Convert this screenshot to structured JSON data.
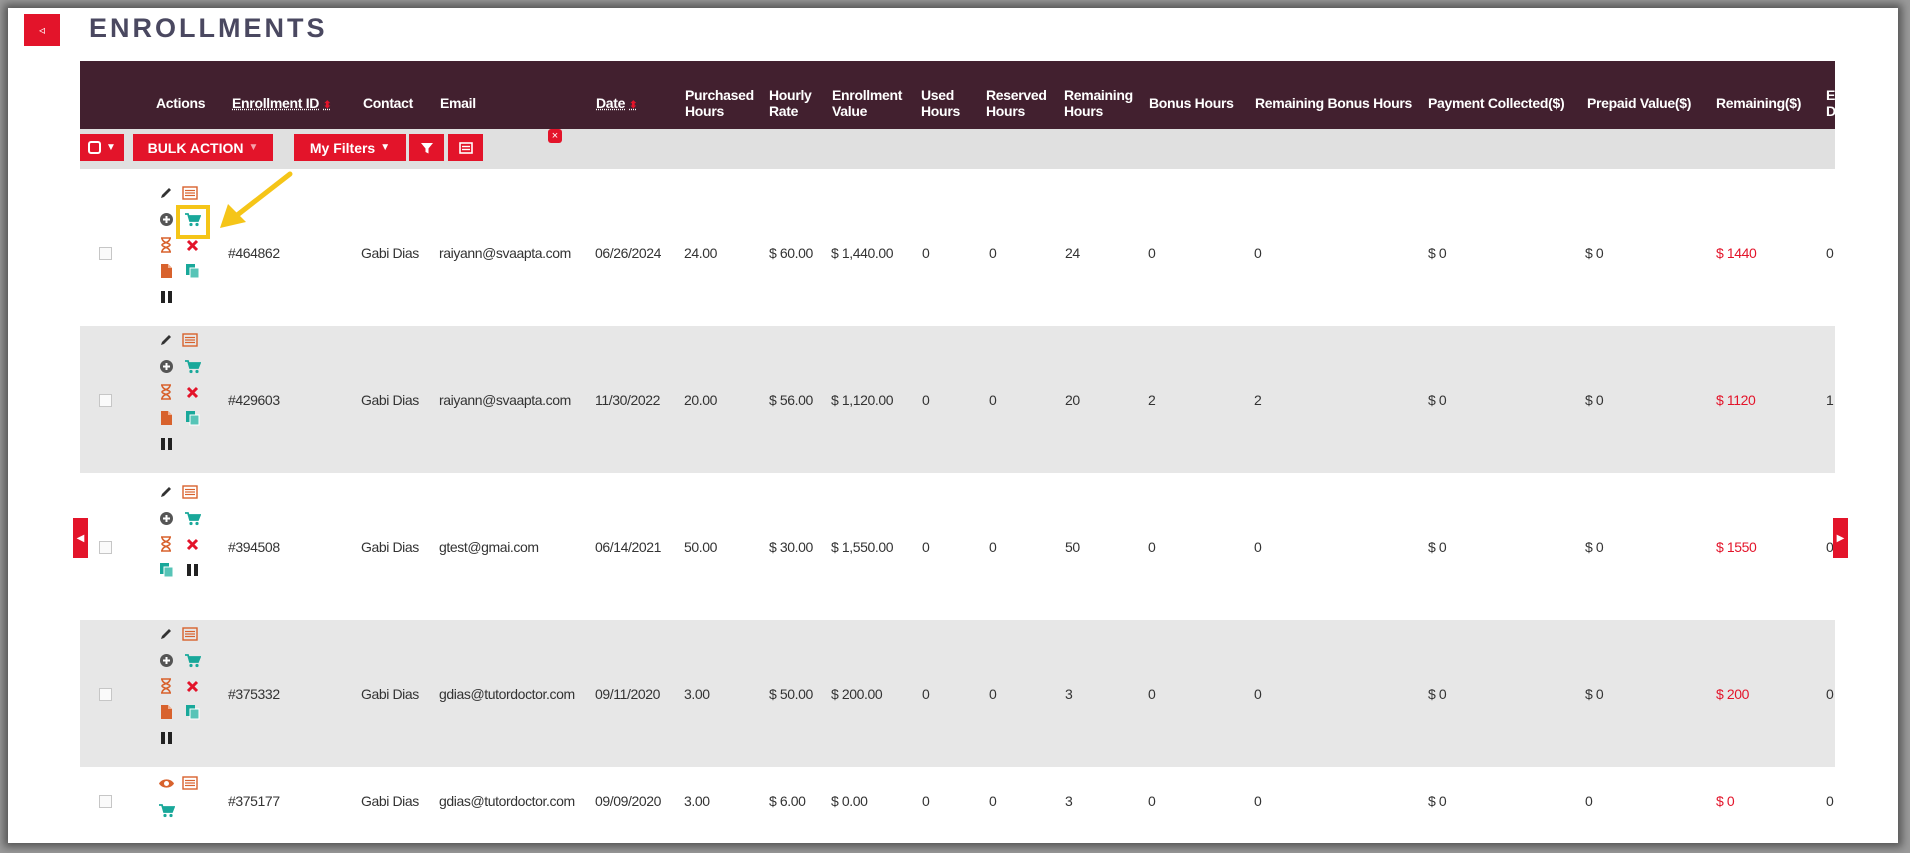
{
  "page": {
    "title": "ENROLLMENTS"
  },
  "colors": {
    "accent": "#e3142a",
    "header_bg": "#42202f",
    "highlight": "#f5c518"
  },
  "columns": [
    {
      "key": "actions",
      "label": "Actions"
    },
    {
      "key": "id",
      "label": "Enrollment ID",
      "sortable": true
    },
    {
      "key": "contact",
      "label": "Contact"
    },
    {
      "key": "email",
      "label": "Email"
    },
    {
      "key": "date",
      "label": "Date",
      "sortable": true
    },
    {
      "key": "purchased",
      "label": "Purchased Hours",
      "lines": [
        "Purchased",
        "Hours"
      ]
    },
    {
      "key": "rate",
      "label": "Hourly Rate",
      "lines": [
        "Hourly",
        "Rate"
      ]
    },
    {
      "key": "value",
      "label": "Enrollment Value",
      "lines": [
        "Enrollment",
        "Value"
      ]
    },
    {
      "key": "used",
      "label": "Used Hours",
      "lines": [
        "Used",
        "Hours"
      ]
    },
    {
      "key": "reserved",
      "label": "Reserved Hours",
      "lines": [
        "Reserved",
        "Hours"
      ]
    },
    {
      "key": "remaining_hours",
      "label": "Remaining Hours",
      "lines": [
        "Remaining",
        "Hours"
      ]
    },
    {
      "key": "bonus",
      "label": "Bonus Hours"
    },
    {
      "key": "remaining_bonus",
      "label": "Remaining Bonus Hours"
    },
    {
      "key": "payment",
      "label": "Payment Collected($)"
    },
    {
      "key": "prepaid",
      "label": "Prepaid Value($)"
    },
    {
      "key": "remaining_amt",
      "label": "Remaining($)"
    },
    {
      "key": "extra",
      "label": "E",
      "lines": [
        "E",
        "D"
      ]
    }
  ],
  "toolbar": {
    "bulk_action_label": "BULK ACTION",
    "my_filters_label": "My Filters",
    "select_icon": "checkbox-square-icon",
    "filter_icon": "funnel-icon",
    "columns_icon": "columns-list-icon",
    "close_icon": "close-icon"
  },
  "rows": [
    {
      "id": "#464862",
      "contact": "Gabi Dias",
      "email": "raiyann@svaapta.com",
      "date": "06/26/2024",
      "purchased": "24.00",
      "rate": "$ 60.00",
      "value": "$ 1,440.00",
      "used": "0",
      "reserved": "0",
      "remaining_hours": "24",
      "bonus": "0",
      "remaining_bonus": "0",
      "payment": "$ 0",
      "prepaid": "$ 0",
      "remaining_amt": "$ 1440",
      "extra": "0",
      "icon_set": "full"
    },
    {
      "id": "#429603",
      "contact": "Gabi Dias",
      "email": "raiyann@svaapta.com",
      "date": "11/30/2022",
      "purchased": "20.00",
      "rate": "$ 56.00",
      "value": "$ 1,120.00",
      "used": "0",
      "reserved": "0",
      "remaining_hours": "20",
      "bonus": "2",
      "remaining_bonus": "2",
      "payment": "$ 0",
      "prepaid": "$ 0",
      "remaining_amt": "$ 1120",
      "extra": "1",
      "icon_set": "full"
    },
    {
      "id": "#394508",
      "contact": "Gabi Dias",
      "email": "gtest@gmai.com",
      "date": "06/14/2021",
      "purchased": "50.00",
      "rate": "$ 30.00",
      "value": "$ 1,550.00",
      "used": "0",
      "reserved": "0",
      "remaining_hours": "50",
      "bonus": "0",
      "remaining_bonus": "0",
      "payment": "$ 0",
      "prepaid": "$ 0",
      "remaining_amt": "$ 1550",
      "extra": "0",
      "icon_set": "compact"
    },
    {
      "id": "#375332",
      "contact": "Gabi Dias",
      "email": "gdias@tutordoctor.com",
      "date": "09/11/2020",
      "purchased": "3.00",
      "rate": "$ 50.00",
      "value": "$ 200.00",
      "used": "0",
      "reserved": "0",
      "remaining_hours": "3",
      "bonus": "0",
      "remaining_bonus": "0",
      "payment": "$ 0",
      "prepaid": "$ 0",
      "remaining_amt": "$ 200",
      "extra": "0",
      "icon_set": "full"
    },
    {
      "id": "#375177",
      "contact": "Gabi Dias",
      "email": "gdias@tutordoctor.com",
      "date": "09/09/2020",
      "purchased": "3.00",
      "rate": "$ 6.00",
      "value": "$ 0.00",
      "used": "0",
      "reserved": "0",
      "remaining_hours": "3",
      "bonus": "0",
      "remaining_bonus": "0",
      "payment": "$ 0",
      "prepaid": "0",
      "remaining_amt": "$ 0",
      "extra": "0",
      "icon_set": "view"
    }
  ]
}
